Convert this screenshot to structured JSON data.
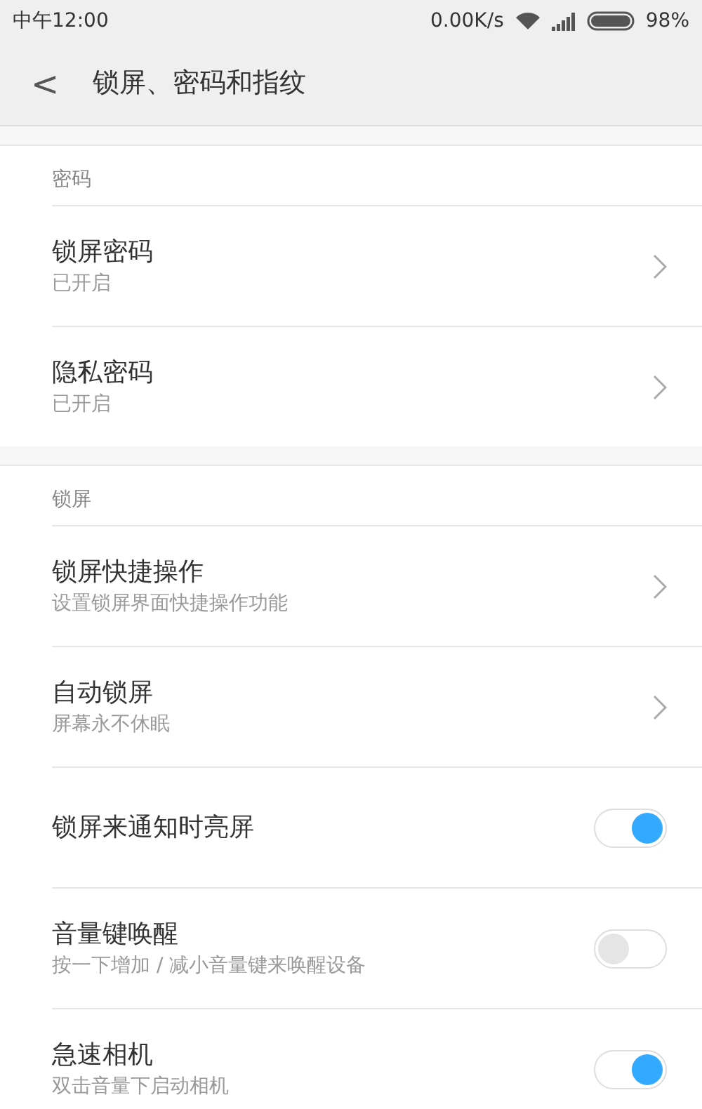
{
  "status_bar": {
    "time": "中午12:00",
    "speed": "0.00K/s",
    "battery": "98%"
  },
  "header": {
    "back": "<",
    "title": "锁屏、密码和指纹"
  },
  "sections": [
    {
      "title": "密码",
      "rows": [
        {
          "kind": "link",
          "title": "锁屏密码",
          "subtitle": "已开启"
        },
        {
          "kind": "link",
          "title": "隐私密码",
          "subtitle": "已开启"
        }
      ]
    },
    {
      "title": "锁屏",
      "rows": [
        {
          "kind": "link",
          "title": "锁屏快捷操作",
          "subtitle": "设置锁屏界面快捷操作功能"
        },
        {
          "kind": "link",
          "title": "自动锁屏",
          "subtitle": "屏幕永不休眠"
        },
        {
          "kind": "toggle",
          "title": "锁屏来通知时亮屏",
          "on": true
        },
        {
          "kind": "toggle",
          "title": "音量键唤醒",
          "subtitle": "按一下增加 / 减小音量键来唤醒设备",
          "on": false
        },
        {
          "kind": "toggle",
          "title": "急速相机",
          "subtitle": "双击音量下启动相机",
          "on": true
        }
      ]
    }
  ]
}
